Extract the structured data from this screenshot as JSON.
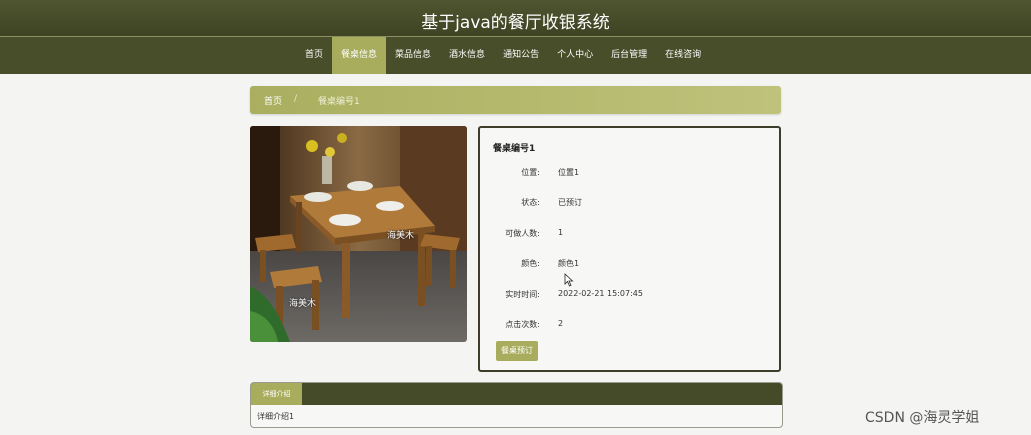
{
  "header": {
    "title": "基于java的餐厅收银系统"
  },
  "nav": {
    "items": [
      {
        "id": "home",
        "label": "首页"
      },
      {
        "id": "tables",
        "label": "餐桌信息"
      },
      {
        "id": "dishes",
        "label": "菜品信息"
      },
      {
        "id": "drinks",
        "label": "酒水信息"
      },
      {
        "id": "notices",
        "label": "通知公告"
      },
      {
        "id": "profile",
        "label": "个人中心"
      },
      {
        "id": "admin",
        "label": "后台管理"
      },
      {
        "id": "consult",
        "label": "在线咨询"
      }
    ],
    "active": "tables"
  },
  "breadcrumb": {
    "home": "首页",
    "separator": "/",
    "current": "餐桌编号1"
  },
  "image": {
    "watermark": "海美木"
  },
  "detail": {
    "title": "餐桌编号1",
    "rows": [
      {
        "label": "位置:",
        "value": "位置1"
      },
      {
        "label": "状态:",
        "value": "已预订"
      },
      {
        "label": "可做人数:",
        "value": "1"
      },
      {
        "label": "颜色:",
        "value": "颜色1"
      },
      {
        "label": "实时时间:",
        "value": "2022-02-21 15:07:45"
      },
      {
        "label": "点击次数:",
        "value": "2"
      }
    ],
    "book_button": "餐桌预订"
  },
  "intro": {
    "tab_label": "详细介绍",
    "content": "详细介绍1"
  },
  "overlay": {
    "watermark": "CSDN @海灵学姐"
  },
  "colors": {
    "header_bg": "#484d2a",
    "accent": "#a7ad5c",
    "page_bg": "#f4f4f2"
  }
}
